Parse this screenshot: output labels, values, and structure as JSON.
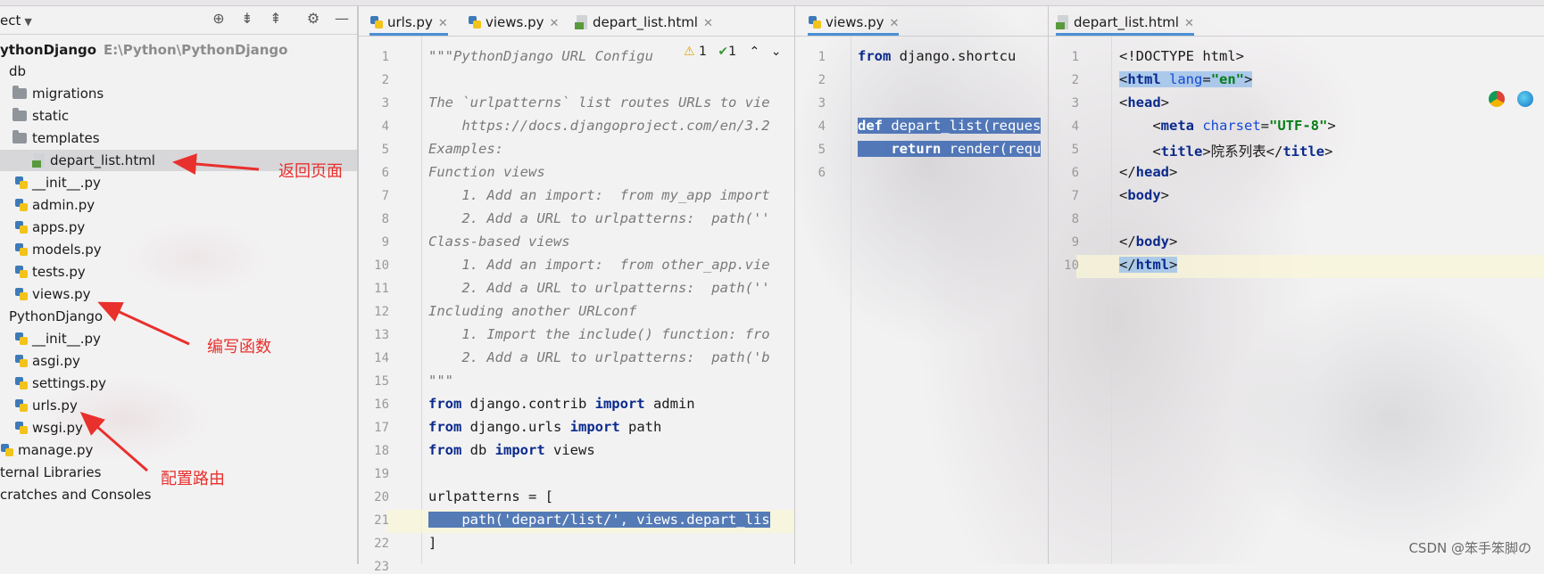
{
  "project": {
    "title": "ect",
    "root_name": "ythonDjango",
    "root_path": "E:\\Python\\PythonDjango",
    "tree": [
      {
        "label": "db",
        "kind": "folder-plain"
      },
      {
        "label": "migrations",
        "kind": "folder"
      },
      {
        "label": "static",
        "kind": "folder"
      },
      {
        "label": "templates",
        "kind": "folder"
      },
      {
        "label": "depart_list.html",
        "kind": "html",
        "selected": true
      },
      {
        "label": "__init__.py",
        "kind": "py"
      },
      {
        "label": "admin.py",
        "kind": "py"
      },
      {
        "label": "apps.py",
        "kind": "py"
      },
      {
        "label": "models.py",
        "kind": "py"
      },
      {
        "label": "tests.py",
        "kind": "py"
      },
      {
        "label": "views.py",
        "kind": "py"
      },
      {
        "label": "PythonDjango",
        "kind": "folder-plain"
      },
      {
        "label": "__init__.py",
        "kind": "py"
      },
      {
        "label": "asgi.py",
        "kind": "py"
      },
      {
        "label": "settings.py",
        "kind": "py"
      },
      {
        "label": "urls.py",
        "kind": "py"
      },
      {
        "label": "wsgi.py",
        "kind": "py"
      },
      {
        "label": "manage.py",
        "kind": "py"
      },
      {
        "label": "ternal Libraries",
        "kind": "plain"
      },
      {
        "label": "cratches and Consoles",
        "kind": "plain"
      }
    ],
    "annotations": {
      "return_page": "返回页面",
      "write_function": "编写函数",
      "config_route": "配置路由"
    }
  },
  "editor1": {
    "tabs": [
      "urls.py",
      "views.py",
      "depart_list.html"
    ],
    "active_tab": 0,
    "inspections": {
      "warnings": "1",
      "ok": "1"
    },
    "lines": [
      "\"\"\"PythonDjango URL Configu",
      "",
      "The `urlpatterns` list routes URLs to vie",
      "    https://docs.djangoproject.com/en/3.2",
      "Examples:",
      "Function views",
      "    1. Add an import:  from my_app import",
      "    2. Add a URL to urlpatterns:  path(''",
      "Class-based views",
      "    1. Add an import:  from other_app.vie",
      "    2. Add a URL to urlpatterns:  path(''",
      "Including another URLconf",
      "    1. Import the include() function: fro",
      "    2. Add a URL to urlpatterns:  path('b",
      "\"\"\"",
      "from django.contrib import admin",
      "from django.urls import path",
      "from db import views",
      "",
      "urlpatterns = [",
      "    path('depart/list/', views.depart_lis",
      "]",
      ""
    ]
  },
  "editor2": {
    "tabs": [
      "views.py"
    ],
    "lines": [
      "from django.shortcu",
      "",
      "",
      "def depart_list(reques",
      "    return render(requ",
      ""
    ]
  },
  "editor3": {
    "tabs": [
      "depart_list.html"
    ],
    "lines": [
      "<!DOCTYPE html>",
      "<html lang=\"en\">",
      "<head>",
      "    <meta charset=\"UTF-8\">",
      "    <title>院系列表</title>",
      "</head>",
      "<body>",
      "",
      "</body>",
      "</html>"
    ]
  },
  "watermark": "CSDN @笨手笨脚の"
}
